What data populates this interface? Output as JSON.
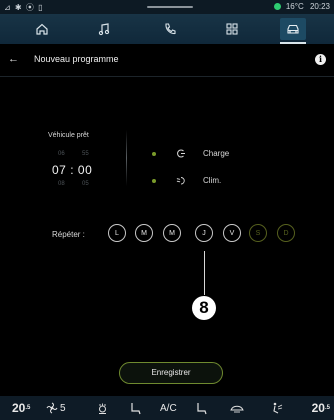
{
  "status": {
    "left_icons": "⊿ ✱ ⦿ ▯",
    "temperature": "16°C",
    "time": "20:23"
  },
  "nav": [
    "home-icon",
    "music-icon",
    "phone-icon",
    "apps-icon",
    "car-icon"
  ],
  "header": {
    "back": "←",
    "title": "Nouveau programme",
    "info": "i"
  },
  "vehicle": {
    "label": "Véhicule prêt",
    "hour_above": "06",
    "min_above": "55",
    "hour": "07",
    "sep": ":",
    "min": "00",
    "hour_below": "08",
    "min_below": "05"
  },
  "options": [
    {
      "label": "Charge",
      "icon": "charge-icon"
    },
    {
      "label": "Clim.",
      "icon": "clim-icon"
    }
  ],
  "repeat": {
    "label": "Répéter :",
    "days": [
      "L",
      "M",
      "M",
      "J",
      "V",
      "S",
      "D"
    ]
  },
  "callout": "8",
  "save_label": "Enregistrer",
  "bottom": {
    "temp_left": "20",
    "temp_left_dec": ".5",
    "fan": "5",
    "ac": "A/C",
    "temp_right": "20",
    "temp_right_dec": ".5"
  },
  "colors": {
    "accent_green": "#6f8a2f",
    "nav_bg": "#183446",
    "status_dot": "#2ecc71"
  }
}
